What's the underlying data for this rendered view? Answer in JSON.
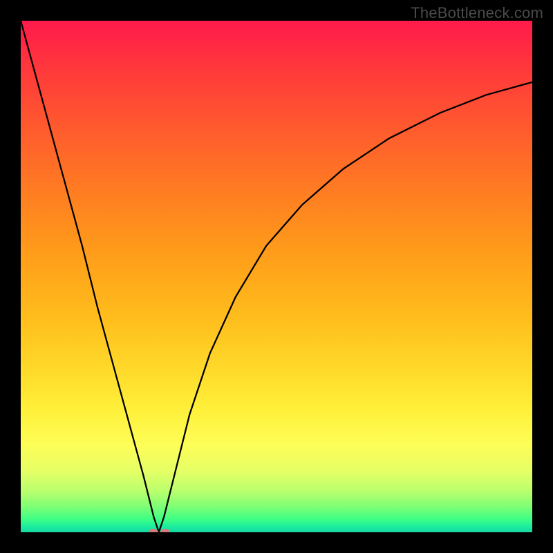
{
  "watermark": "TheBottleneck.com",
  "colors": {
    "frame": "#000000",
    "curve": "#000000",
    "dot": "#d67b7b"
  },
  "chart_data": {
    "type": "line",
    "title": "",
    "xlabel": "",
    "ylabel": "",
    "xlim": [
      0,
      100
    ],
    "ylim": [
      0,
      100
    ],
    "grid": false,
    "legend": false,
    "annotations": [],
    "series": [
      {
        "name": "bottleneck-curve",
        "x": [
          0,
          3,
          6,
          9,
          12,
          15,
          18,
          21,
          24,
          26,
          27,
          28,
          30,
          33,
          37,
          42,
          48,
          55,
          63,
          72,
          82,
          91,
          100
        ],
        "y": [
          100,
          89,
          78,
          67,
          56,
          44,
          33,
          22,
          11,
          3,
          0,
          3,
          11,
          23,
          35,
          46,
          56,
          64,
          71,
          77,
          82,
          85.5,
          88
        ]
      }
    ],
    "markers": [
      {
        "name": "minimum-dot-left",
        "x": 26.0,
        "y": 0
      },
      {
        "name": "minimum-dot-right",
        "x": 28.2,
        "y": 0
      }
    ],
    "notes": "Values are estimated from the rasterized chart; axes have no visible tick labels so 0–100 normalized scale is assumed. The curve is a V-shape with minimum near x≈27 and a decelerating rise toward the right edge."
  }
}
